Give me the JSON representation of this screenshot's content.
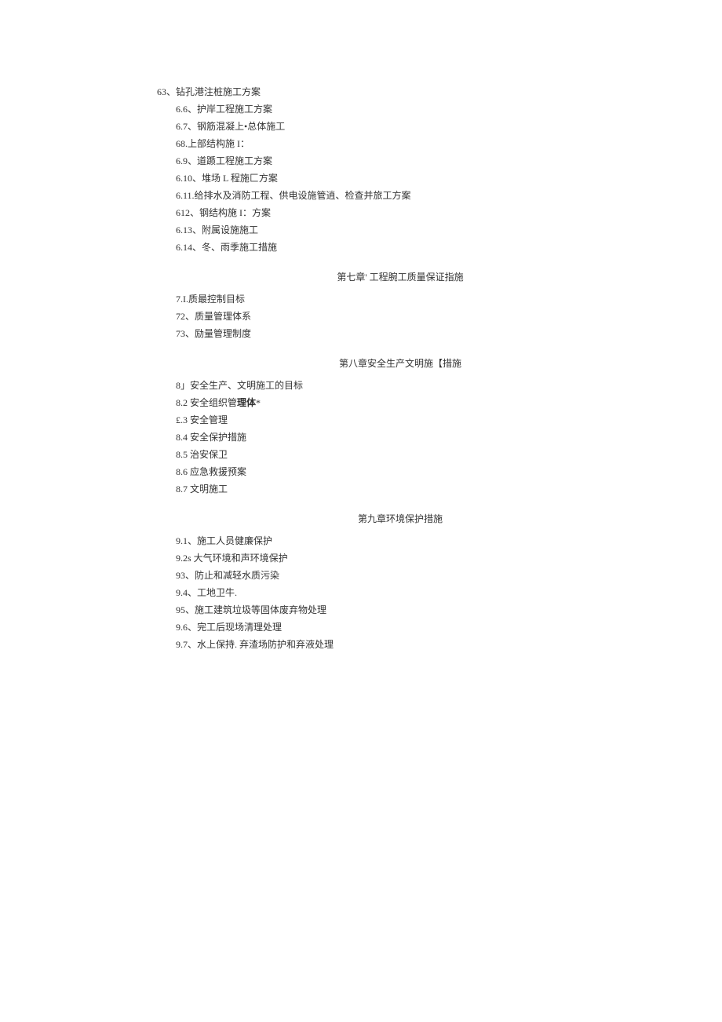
{
  "chapter6": {
    "items": [
      "63、钻孔港注桩施工方案",
      "6.6、护岸工程施工方案",
      "6.7、钢筋混凝上•总体施工",
      "68.上部结构施 I：",
      "6.9、道踬工程施工方案",
      "6.10、堆场 L 程施匚方案",
      "6.11.给排水及消防工程、供电设施管逍、检查并旅工方案",
      "612、钢结构施 I：方案",
      "6.13、附属设施施工",
      "6.14、冬、雨季施工措施"
    ]
  },
  "chapter7": {
    "title": "第七章' 工程腕工质量保证指施",
    "items": [
      "7.I.质最控制目标",
      "72、质量管理体系",
      "73、励量管理制度"
    ]
  },
  "chapter8": {
    "title": "第八章安全生产文明施【措施",
    "items": [
      {
        "text": "8」安全生产、文明施工的目标"
      },
      {
        "prefix": "8.2 安全组织管",
        "bold": "理体",
        "suffix": "*"
      },
      {
        "text": "£.3 安全管理"
      },
      {
        "text": "8.4 安全保护措施"
      },
      {
        "text": "8.5 治安保卫"
      },
      {
        "text": "8.6 应急救援预案"
      },
      {
        "text": "8.7 文明施工"
      }
    ]
  },
  "chapter9": {
    "title": "第九章环境保护措施",
    "items": [
      "9.1、施工人员健廉保护",
      "9.2s 大气环境和声环境保护",
      "93、防止和减轻水质污染",
      "9.4、工地卫牛.",
      "95、施工建筑垃圾等固体废弃物处理",
      "9.6、完工后现场淸理处理",
      "9.7、水上保持. 弃渣场防护和弃液处理"
    ]
  }
}
